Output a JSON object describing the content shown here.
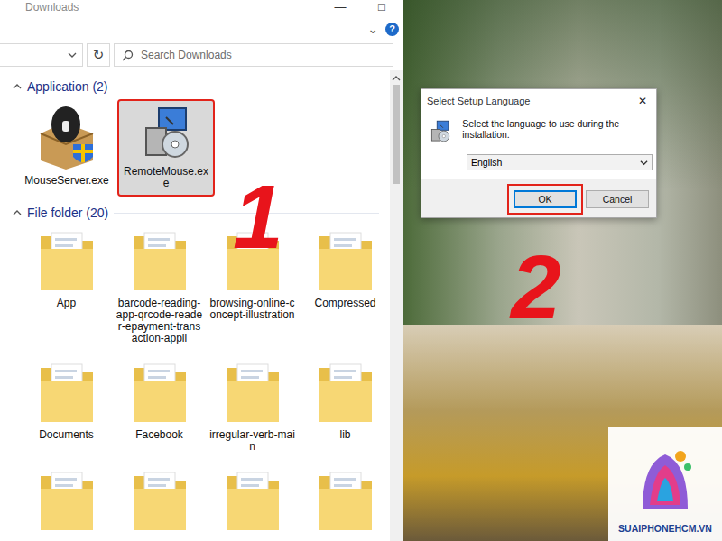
{
  "explorer": {
    "title": "Downloads",
    "controls": [
      "—",
      "□"
    ],
    "expand": "⌄",
    "help": "?",
    "refresh": "↻",
    "search": {
      "placeholder": "Search Downloads"
    },
    "groups": [
      {
        "label": "Application (2)",
        "kind": "app",
        "items": [
          {
            "name": "MouseServer.exe",
            "kind": "server",
            "selected": false
          },
          {
            "name": "RemoteMouse.exe",
            "kind": "installer",
            "selected": true
          }
        ]
      },
      {
        "label": "File folder (20)",
        "kind": "folder",
        "items": [
          {
            "name": "App",
            "kind": "folder",
            "selected": false
          },
          {
            "name": "barcode-reading-app-qrcode-reader-epayment-transaction-appli",
            "kind": "folder",
            "selected": false
          },
          {
            "name": "browsing-online-concept-illustration",
            "kind": "folder",
            "selected": false
          },
          {
            "name": "Compressed",
            "kind": "folder",
            "selected": false
          },
          {
            "name": "Documents",
            "kind": "folder",
            "selected": false
          },
          {
            "name": "Facebook",
            "kind": "folder",
            "selected": false
          },
          {
            "name": "irregular-verb-main",
            "kind": "folder",
            "selected": false
          },
          {
            "name": "lib",
            "kind": "folder",
            "selected": false
          },
          {
            "name": "",
            "kind": "folder",
            "selected": false
          },
          {
            "name": "",
            "kind": "folder",
            "selected": false
          },
          {
            "name": "",
            "kind": "folder",
            "selected": false
          },
          {
            "name": "",
            "kind": "folder",
            "selected": false
          }
        ]
      }
    ]
  },
  "dialog": {
    "title": "Select Setup Language",
    "close": "✕",
    "message": "Select the language to use during the installation.",
    "language": "English",
    "buttons": [
      {
        "label": "OK",
        "selected": true
      },
      {
        "label": "Cancel",
        "selected": false
      }
    ]
  },
  "steps": [
    "1",
    "2"
  ],
  "watermark": "SUAIPHONEHCM.VN"
}
